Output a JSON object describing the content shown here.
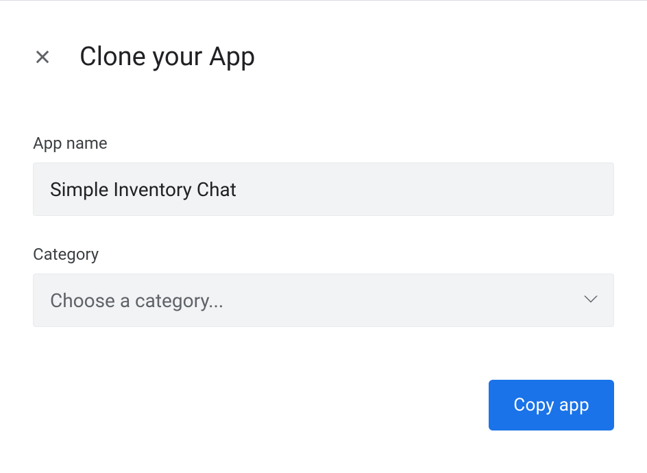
{
  "dialog": {
    "title": "Clone your App"
  },
  "fields": {
    "app_name": {
      "label": "App name",
      "value": "Simple Inventory Chat"
    },
    "category": {
      "label": "Category",
      "placeholder": "Choose a category..."
    }
  },
  "actions": {
    "copy": "Copy app"
  }
}
